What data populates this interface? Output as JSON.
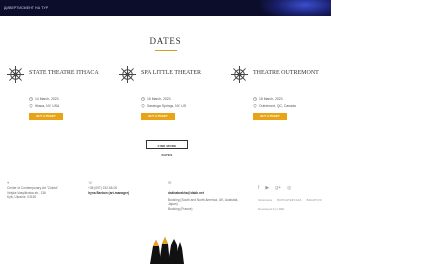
{
  "hero": {
    "caption": "ДИВЕРТИСМЕНТ НА ТУР"
  },
  "dates": {
    "title": "DATES",
    "events": [
      {
        "name": "STATE THEATRE ITHACA",
        "date": "14 March, 2023",
        "location": "Ithaca, NY, USA",
        "button": "BUY A TICKET"
      },
      {
        "name": "SPA LITTLE THEATER",
        "date": "16 March, 2023",
        "location": "Saratoga Springs, NY, US",
        "button": "BUY A TICKET"
      },
      {
        "name": "THEATRE OUTREMONT",
        "date": "18 March, 2023",
        "location": "Outremont, QC, Canada",
        "button": "BUY A TICKET"
      }
    ],
    "more_button": "FIND MORE DATES"
  },
  "footer": {
    "address": [
      "Center of Contemporary Art \"Zolota\"",
      "Velyka Vasylkivska str., 136",
      "Kyiv, Ukraine, 03150"
    ],
    "contact": [
      "+38 (097) 232-66-00",
      "Iryna Barbon (art-manager)"
    ],
    "email": "dakhabrakha@dakh.net",
    "booking": [
      "Booking (South and North America, UK, Australia,",
      "Japan)",
      "Booking (France)"
    ],
    "partners": [
      "Ukrainians",
      "ВОЛОНТЕРСЬКА",
      "ВАКАРЧУК"
    ],
    "developed": "Developed by LIME",
    "colors": {
      "accent": "#e8a317",
      "hero": "#0b0d2a"
    }
  }
}
